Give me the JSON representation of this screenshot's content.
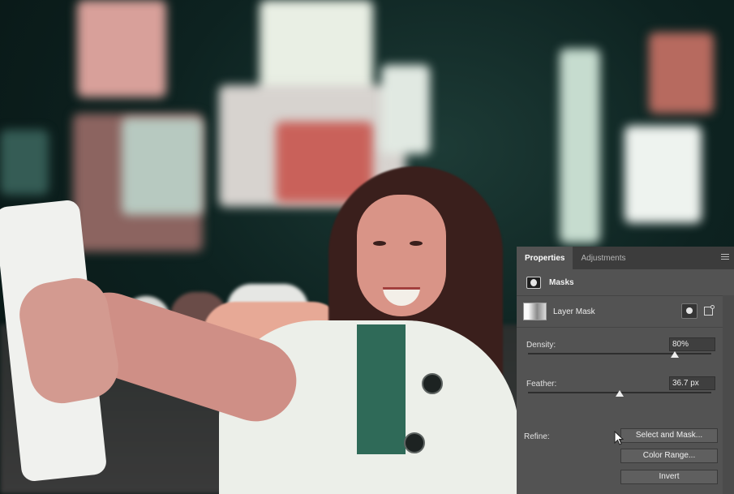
{
  "panel": {
    "tabs": [
      {
        "label": "Properties",
        "active": true
      },
      {
        "label": "Adjustments",
        "active": false
      }
    ],
    "header_title": "Masks",
    "layer_label": "Layer Mask",
    "density": {
      "label": "Density:",
      "value_text": "80%",
      "value": 80
    },
    "feather": {
      "label": "Feather:",
      "value_text": "36.7 px",
      "value_fraction": 0.5
    },
    "refine_label": "Refine:",
    "buttons": {
      "select_and_mask": "Select and Mask...",
      "color_range": "Color Range...",
      "invert": "Invert"
    },
    "icons": [
      "panel-menu-icon",
      "mask-icon",
      "pixel-mask-icon",
      "vector-mask-icon",
      "mouse-cursor-icon"
    ]
  },
  "colors": {
    "panel_bg": "#535353",
    "tab_bar_bg": "#3c3c3c",
    "field_bg": "#3f3f3f",
    "button_bg": "#5f5f5f"
  }
}
